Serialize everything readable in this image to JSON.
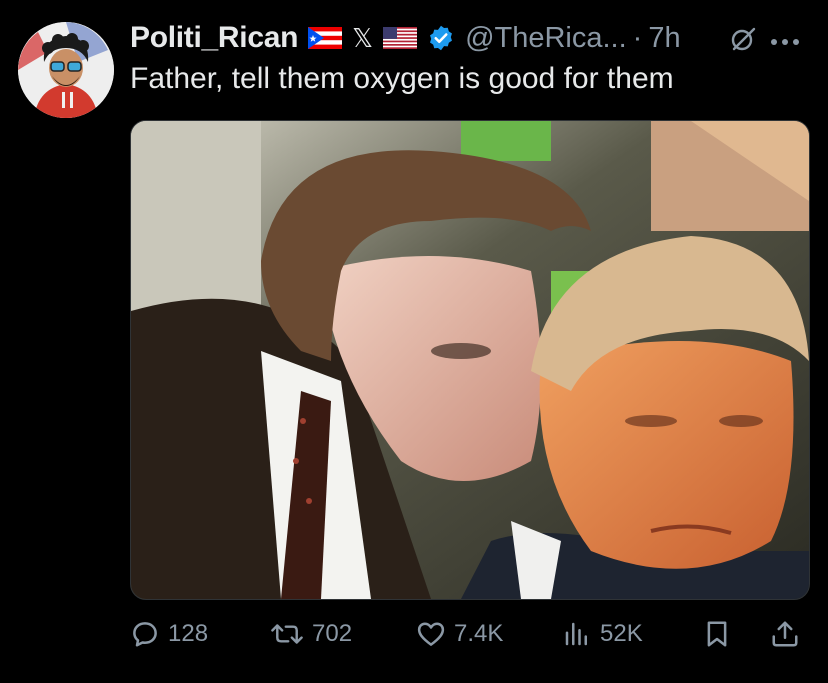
{
  "post": {
    "display_name": "Politi_Rican",
    "badges": [
      "puerto-rico-flag-icon",
      "x-icon",
      "us-flag-icon",
      "verified-badge-icon"
    ],
    "x_glyph": "𝕏",
    "handle": "@TheRica...",
    "separator": "·",
    "time": "7h",
    "text": "Father, tell them oxygen is good for them",
    "media_alt": "Photo of a young man in a dark suit leaning toward an older man with orange-tinted skin and blond hair"
  },
  "actions": {
    "replies": "128",
    "reposts": "702",
    "likes": "7.4K",
    "views": "52K"
  },
  "colors": {
    "background": "#000000",
    "primary_text": "#e7e9ea",
    "secondary_text": "#8b98a5",
    "verified_blue": "#1d9bf0"
  }
}
